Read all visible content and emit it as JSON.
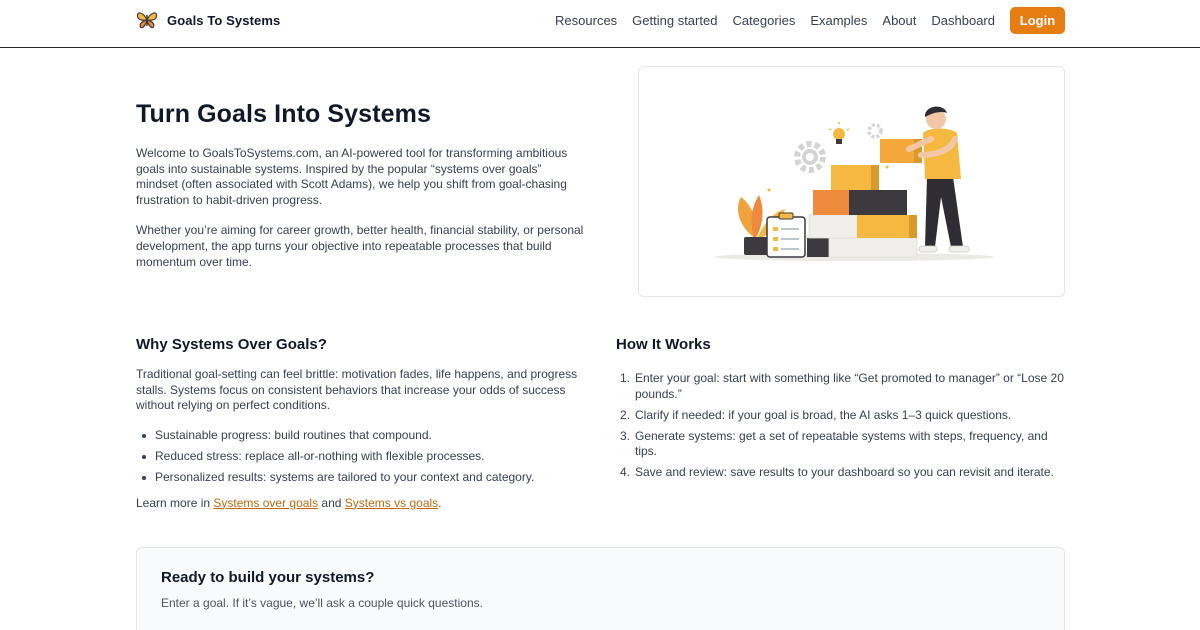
{
  "header": {
    "brand": "Goals To Systems",
    "nav": [
      "Resources",
      "Getting started",
      "Categories",
      "Examples",
      "About",
      "Dashboard"
    ],
    "login_label": "Login"
  },
  "hero": {
    "title": "Turn Goals Into Systems",
    "paragraph1": "Welcome to GoalsToSystems.com, an AI-powered tool for transforming ambitious goals into sustainable systems. Inspired by the popular “systems over goals” mindset (often associated with Scott Adams), we help you shift from goal-chasing frustration to habit-driven progress.",
    "paragraph2": "Whether you’re aiming for career growth, better health, financial stability, or personal development, the app turns your objective into repeatable processes that build momentum over time."
  },
  "why": {
    "title": "Why Systems Over Goals?",
    "paragraph": "Traditional goal-setting can feel brittle: motivation fades, life happens, and progress stalls. Systems focus on consistent behaviors that increase your odds of success without relying on perfect conditions.",
    "bullets": [
      "Sustainable progress: build routines that compound.",
      "Reduced stress: replace all-or-nothing with flexible processes.",
      "Personalized results: systems are tailored to your context and category."
    ],
    "learn_prefix": "Learn more in ",
    "link1": "Systems over goals",
    "learn_and": " and ",
    "link2": "Systems vs goals",
    "learn_suffix": "."
  },
  "how": {
    "title": "How It Works",
    "steps": [
      "Enter your goal: start with something like “Get promoted to manager” or “Lose 20 pounds.”",
      "Clarify if needed: if your goal is broad, the AI asks 1–3 quick questions.",
      "Generate systems: get a set of repeatable systems with steps, frequency, and tips.",
      "Save and review: save results to your dashboard so you can revisit and iterate."
    ],
    "step_numbers": [
      "1.",
      "2.",
      "3.",
      "4."
    ]
  },
  "cta": {
    "title": "Ready to build your systems?",
    "subtitle": "Enter a goal. If it’s vague, we’ll ask a couple quick questions."
  },
  "colors": {
    "accent": "#e57d12",
    "link": "#c2690f",
    "box_yellow": "#f5b942",
    "box_orange": "#ef8a3c",
    "box_dark": "#3d3a3f",
    "box_light": "#f1efec"
  },
  "icons": {
    "brand": "butterfly-logo-icon",
    "illustration": "person-stacking-boxes-illustration"
  }
}
